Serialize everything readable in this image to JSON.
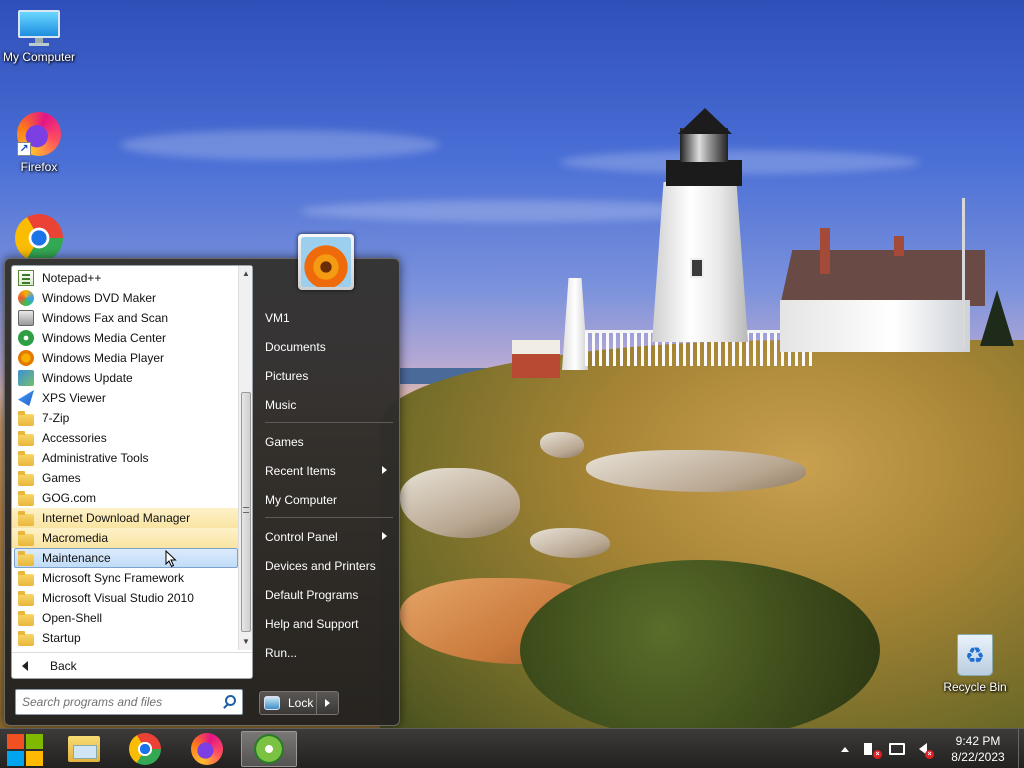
{
  "desktop": {
    "icons": [
      {
        "label": "My Computer",
        "icon": "monitor-icon"
      },
      {
        "label": "Firefox",
        "icon": "firefox-icon"
      },
      {
        "label": "",
        "icon": "chrome-icon"
      },
      {
        "label": "Recycle Bin",
        "icon": "recycle-bin-icon"
      }
    ]
  },
  "start_menu": {
    "programs": [
      {
        "label": "Notepad++",
        "icon": "notepad-icon"
      },
      {
        "label": "Windows DVD Maker",
        "icon": "dvd-maker-icon"
      },
      {
        "label": "Windows Fax and Scan",
        "icon": "fax-icon"
      },
      {
        "label": "Windows Media Center",
        "icon": "media-center-icon"
      },
      {
        "label": "Windows Media Player",
        "icon": "media-player-icon"
      },
      {
        "label": "Windows Update",
        "icon": "windows-update-icon"
      },
      {
        "label": "XPS Viewer",
        "icon": "xps-viewer-icon"
      },
      {
        "label": "7-Zip",
        "icon": "folder-icon"
      },
      {
        "label": "Accessories",
        "icon": "folder-icon"
      },
      {
        "label": "Administrative Tools",
        "icon": "folder-icon"
      },
      {
        "label": "Games",
        "icon": "folder-icon"
      },
      {
        "label": "GOG.com",
        "icon": "folder-icon"
      },
      {
        "label": "Internet Download Manager",
        "icon": "folder-icon",
        "state": "highlight"
      },
      {
        "label": "Macromedia",
        "icon": "folder-icon",
        "state": "highlight"
      },
      {
        "label": "Maintenance",
        "icon": "folder-icon",
        "state": "selected"
      },
      {
        "label": "Microsoft Sync Framework",
        "icon": "folder-icon"
      },
      {
        "label": "Microsoft Visual Studio 2010",
        "icon": "folder-icon"
      },
      {
        "label": "Open-Shell",
        "icon": "folder-icon"
      },
      {
        "label": "Startup",
        "icon": "folder-icon"
      }
    ],
    "back_label": "Back",
    "search_placeholder": "Search programs and files",
    "right_items": [
      {
        "label": "VM1"
      },
      {
        "label": "Documents"
      },
      {
        "label": "Pictures"
      },
      {
        "label": "Music"
      },
      {
        "separator": true
      },
      {
        "label": "Games"
      },
      {
        "label": "Recent Items",
        "submenu": true
      },
      {
        "label": "My Computer"
      },
      {
        "separator": true
      },
      {
        "label": "Control Panel",
        "submenu": true
      },
      {
        "label": "Devices and Printers"
      },
      {
        "label": "Default Programs"
      },
      {
        "label": "Help and Support"
      },
      {
        "label": "Run..."
      }
    ],
    "lock_label": "Lock"
  },
  "taskbar": {
    "apps": [
      {
        "name": "file-explorer",
        "icon": "folder-icon",
        "active": false
      },
      {
        "name": "chrome",
        "icon": "chrome-icon",
        "active": false
      },
      {
        "name": "firefox",
        "icon": "firefox-icon",
        "active": false
      },
      {
        "name": "internet-download-manager",
        "icon": "idm-icon",
        "active": true
      }
    ],
    "clock": {
      "time": "9:42 PM",
      "date": "8/22/2023"
    }
  },
  "colors": {
    "start_red": "#f25022",
    "start_green": "#7fba00",
    "start_blue": "#00a4ef",
    "start_yellow": "#ffb900",
    "highlight": "#fae4a2",
    "selected": "#c1dcf8"
  }
}
